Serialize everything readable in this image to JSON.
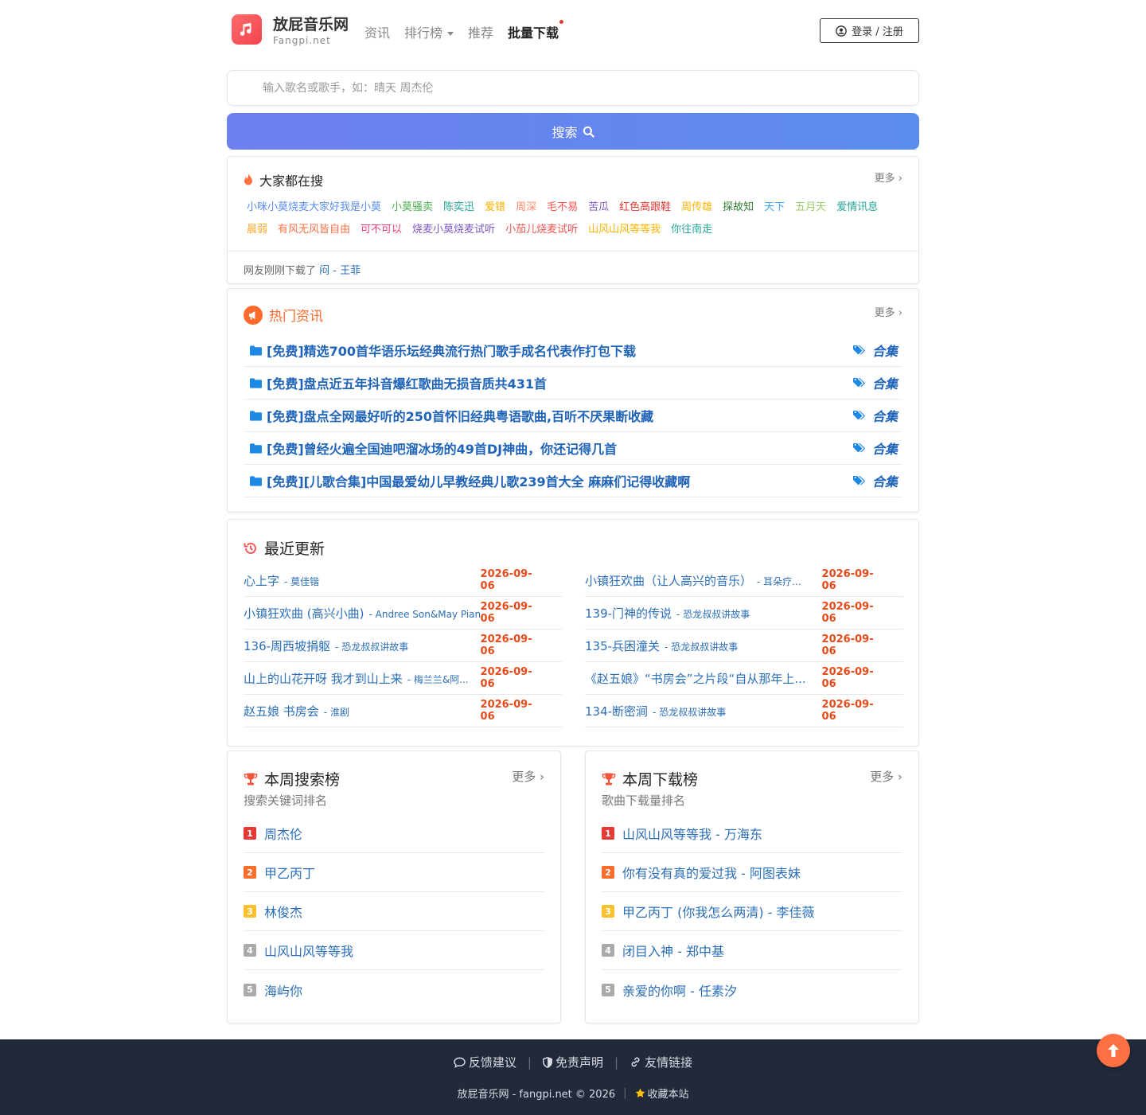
{
  "brand": {
    "title": "放屁音乐网",
    "subtitle": "Fangpi.net",
    "accent": "#f0434f"
  },
  "nav": {
    "items": [
      "资讯",
      "排行榜",
      "推荐",
      "批量下载"
    ]
  },
  "login": {
    "label": "登录 / 注册"
  },
  "search": {
    "placeholder": "输入歌名或歌手，如：晴天 周杰伦",
    "button_label": "搜索"
  },
  "hot_search": {
    "title": "大家都在搜",
    "more": "更多",
    "tags": [
      {
        "text": "小咪小莫烧麦大家好我是小莫",
        "color": "#5b8def"
      },
      {
        "text": "小莫骚卖",
        "color": "#4caf50"
      },
      {
        "text": "陈奕迅",
        "color": "#26a69a"
      },
      {
        "text": "爱错",
        "color": "#ffb300"
      },
      {
        "text": "周深",
        "color": "#ff8a65"
      },
      {
        "text": "毛不易",
        "color": "#ef5350"
      },
      {
        "text": "苦瓜",
        "color": "#7e57c2"
      },
      {
        "text": "红色高跟鞋",
        "color": "#e53935"
      },
      {
        "text": "周传雄",
        "color": "#ffb300"
      },
      {
        "text": "探故知",
        "color": "#2e7d32"
      },
      {
        "text": "天下",
        "color": "#42a5f5"
      },
      {
        "text": "五月天",
        "color": "#9ccc65"
      },
      {
        "text": "爱情讯息",
        "color": "#26a69a"
      },
      {
        "text": "晨弱",
        "color": "#ffa726"
      },
      {
        "text": "有风无风皆自由",
        "color": "#ff7043"
      },
      {
        "text": "可不可以",
        "color": "#ec407a"
      },
      {
        "text": "烧麦小莫烧麦试听",
        "color": "#7e57c2"
      },
      {
        "text": "小茄儿烧麦试听",
        "color": "#ef5350"
      },
      {
        "text": "山风山风等等我",
        "color": "#ffb300"
      },
      {
        "text": "你往南走",
        "color": "#26a69a"
      }
    ],
    "recent_label": "网友刚刚下载了",
    "recent_song": "闷 - 王菲"
  },
  "news": {
    "title": "热门资讯",
    "more": "更多",
    "tag_label": "合集",
    "items": [
      "[免费]精选700首华语乐坛经典流行热门歌手成名代表作打包下载",
      "[免费]盘点近五年抖音爆红歌曲无损音质共431首",
      "[免费]盘点全网最好听的250首怀旧经典粤语歌曲,百听不厌果断收藏",
      "[免费]曾经火遍全国迪吧溜冰场的49首DJ神曲，你还记得几首",
      "[免费][儿歌合集]中国最爱幼儿早教经典儿歌239首大全 麻麻们记得收藏啊"
    ]
  },
  "recent": {
    "title": "最近更新",
    "left": [
      {
        "song": "心上字",
        "artist": "- 莫佳锴",
        "date": "2026-09-06"
      },
      {
        "song": "小镇狂欢曲 (高兴小曲)",
        "artist": "- Andree Son&May Pian",
        "date": "2026-09-06"
      },
      {
        "song": "136-周西坡捐躯",
        "artist": "- 恐龙叔叔讲故事",
        "date": "2026-09-06"
      },
      {
        "song": "山上的山花开呀 我才到山上来",
        "artist": "- 梅兰兰&阿...",
        "date": "2026-09-06"
      },
      {
        "song": "赵五娘 书房会",
        "artist": "- 淮剧",
        "date": "2026-09-06"
      }
    ],
    "right": [
      {
        "song": "小镇狂欢曲（让人高兴的音乐）",
        "artist": "- 耳朵疗...",
        "date": "2026-09-06"
      },
      {
        "song": "139-门神的传说",
        "artist": "- 恐龙叔叔讲故事",
        "date": "2026-09-06"
      },
      {
        "song": "135-兵困潼关",
        "artist": "- 恐龙叔叔讲故事",
        "date": "2026-09-06"
      },
      {
        "song": "《赵五娘》“书房会”之片段“自从那年上...",
        "artist": "",
        "date": "2026-09-06"
      },
      {
        "song": "134-断密涧",
        "artist": "- 恐龙叔叔讲故事",
        "date": "2026-09-06"
      }
    ]
  },
  "search_rank": {
    "title": "本周搜索榜",
    "subtitle": "搜索关键词排名",
    "more": "更多",
    "items": [
      {
        "num": "1",
        "text": "周杰伦",
        "color": "#e53935"
      },
      {
        "num": "2",
        "text": "甲乙丙丁",
        "color": "#fb6d2a"
      },
      {
        "num": "3",
        "text": "林俊杰",
        "color": "#fbc02d"
      },
      {
        "num": "4",
        "text": "山风山风等等我",
        "color": "#aaaaaa"
      },
      {
        "num": "5",
        "text": "海屿你",
        "color": "#aaaaaa"
      }
    ]
  },
  "download_rank": {
    "title": "本周下载榜",
    "subtitle": "歌曲下载量排名",
    "more": "更多",
    "items": [
      {
        "num": "1",
        "text": "山风山风等等我 - 万海东",
        "color": "#e53935"
      },
      {
        "num": "2",
        "text": "你有没有真的爱过我 - 阿图表妹",
        "color": "#fb6d2a"
      },
      {
        "num": "3",
        "text": "甲乙丙丁 (你我怎么两清) - 李佳薇",
        "color": "#fbc02d"
      },
      {
        "num": "4",
        "text": "闭目入神 - 郑中基",
        "color": "#aaaaaa"
      },
      {
        "num": "5",
        "text": "亲爱的你啊 - 任素汐",
        "color": "#aaaaaa"
      }
    ]
  },
  "footer": {
    "feedback": "反馈建议",
    "disclaimer": "免责声明",
    "links": "友情链接",
    "copyright": "放屁音乐网 - fangpi.net © 2026",
    "bookmark": "收藏本站"
  }
}
